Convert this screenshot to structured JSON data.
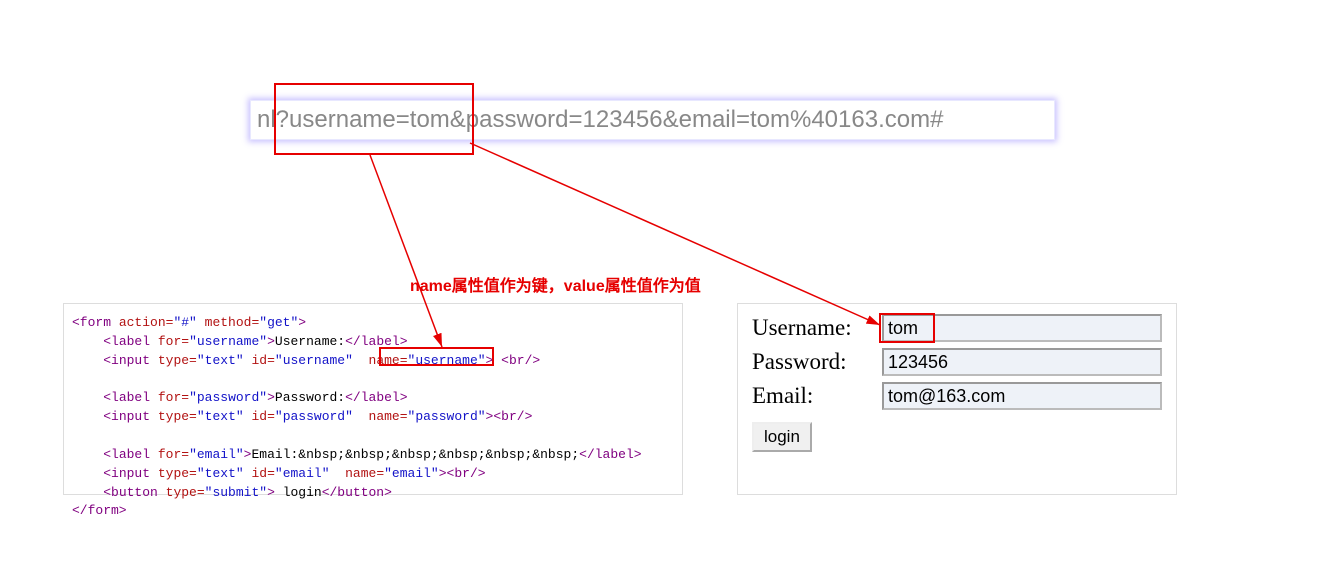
{
  "url": {
    "pre": "nl?",
    "highlighted": "username=tom",
    "post": "&password=123456&email=tom%40163.com#"
  },
  "annotation": "name属性值作为键，value属性值作为值",
  "code": {
    "line1": {
      "form": "<form",
      "action_attr": "action=",
      "action_val": "\"#\"",
      "method_attr": "method=",
      "method_val": "\"get\"",
      "close": ">"
    },
    "l_user": {
      "open": "<label",
      "for_attr": "for=",
      "for_val": "\"username\"",
      "gt": ">",
      "text": "Username:",
      "close": "</label>"
    },
    "i_user": {
      "open": "<input",
      "type_attr": "type=",
      "type_val": "\"text\"",
      "id_attr": "id=",
      "id_val": "\"username\"",
      "name_attr": "name=",
      "name_val": "\"username\"",
      "close": ">",
      "br": "<br/>"
    },
    "l_pass": {
      "open": "<label",
      "for_attr": "for=",
      "for_val": "\"password\"",
      "gt": ">",
      "text": "Password:",
      "close": "</label>"
    },
    "i_pass": {
      "open": "<input",
      "type_attr": "type=",
      "type_val": "\"text\"",
      "id_attr": "id=",
      "id_val": "\"password\"",
      "name_attr": "name=",
      "name_val": "\"password\"",
      "close": ">",
      "br": "<br/>"
    },
    "l_email": {
      "open": "<label",
      "for_attr": "for=",
      "for_val": "\"email\"",
      "gt": ">",
      "text": "Email:&nbsp;&nbsp;&nbsp;&nbsp;&nbsp;&nbsp;",
      "close": "</label>"
    },
    "i_email": {
      "open": "<input",
      "type_attr": "type=",
      "type_val": "\"text\"",
      "id_attr": "id=",
      "id_val": "\"email\"",
      "name_attr": "name=",
      "name_val": "\"email\"",
      "close": ">",
      "br": "<br/>"
    },
    "btn": {
      "open": "<button",
      "type_attr": "type=",
      "type_val": "\"submit\"",
      "gt": ">",
      "text": " login",
      "close": "</button>"
    },
    "form_close": "</form>"
  },
  "form": {
    "username_label": "Username:",
    "username_value": "tom",
    "password_label": "Password:",
    "password_value": "123456",
    "email_label": "Email:",
    "email_value": "tom@163.com",
    "login_label": "login"
  },
  "colors": {
    "red": "#e60000",
    "gray_text": "#888"
  }
}
